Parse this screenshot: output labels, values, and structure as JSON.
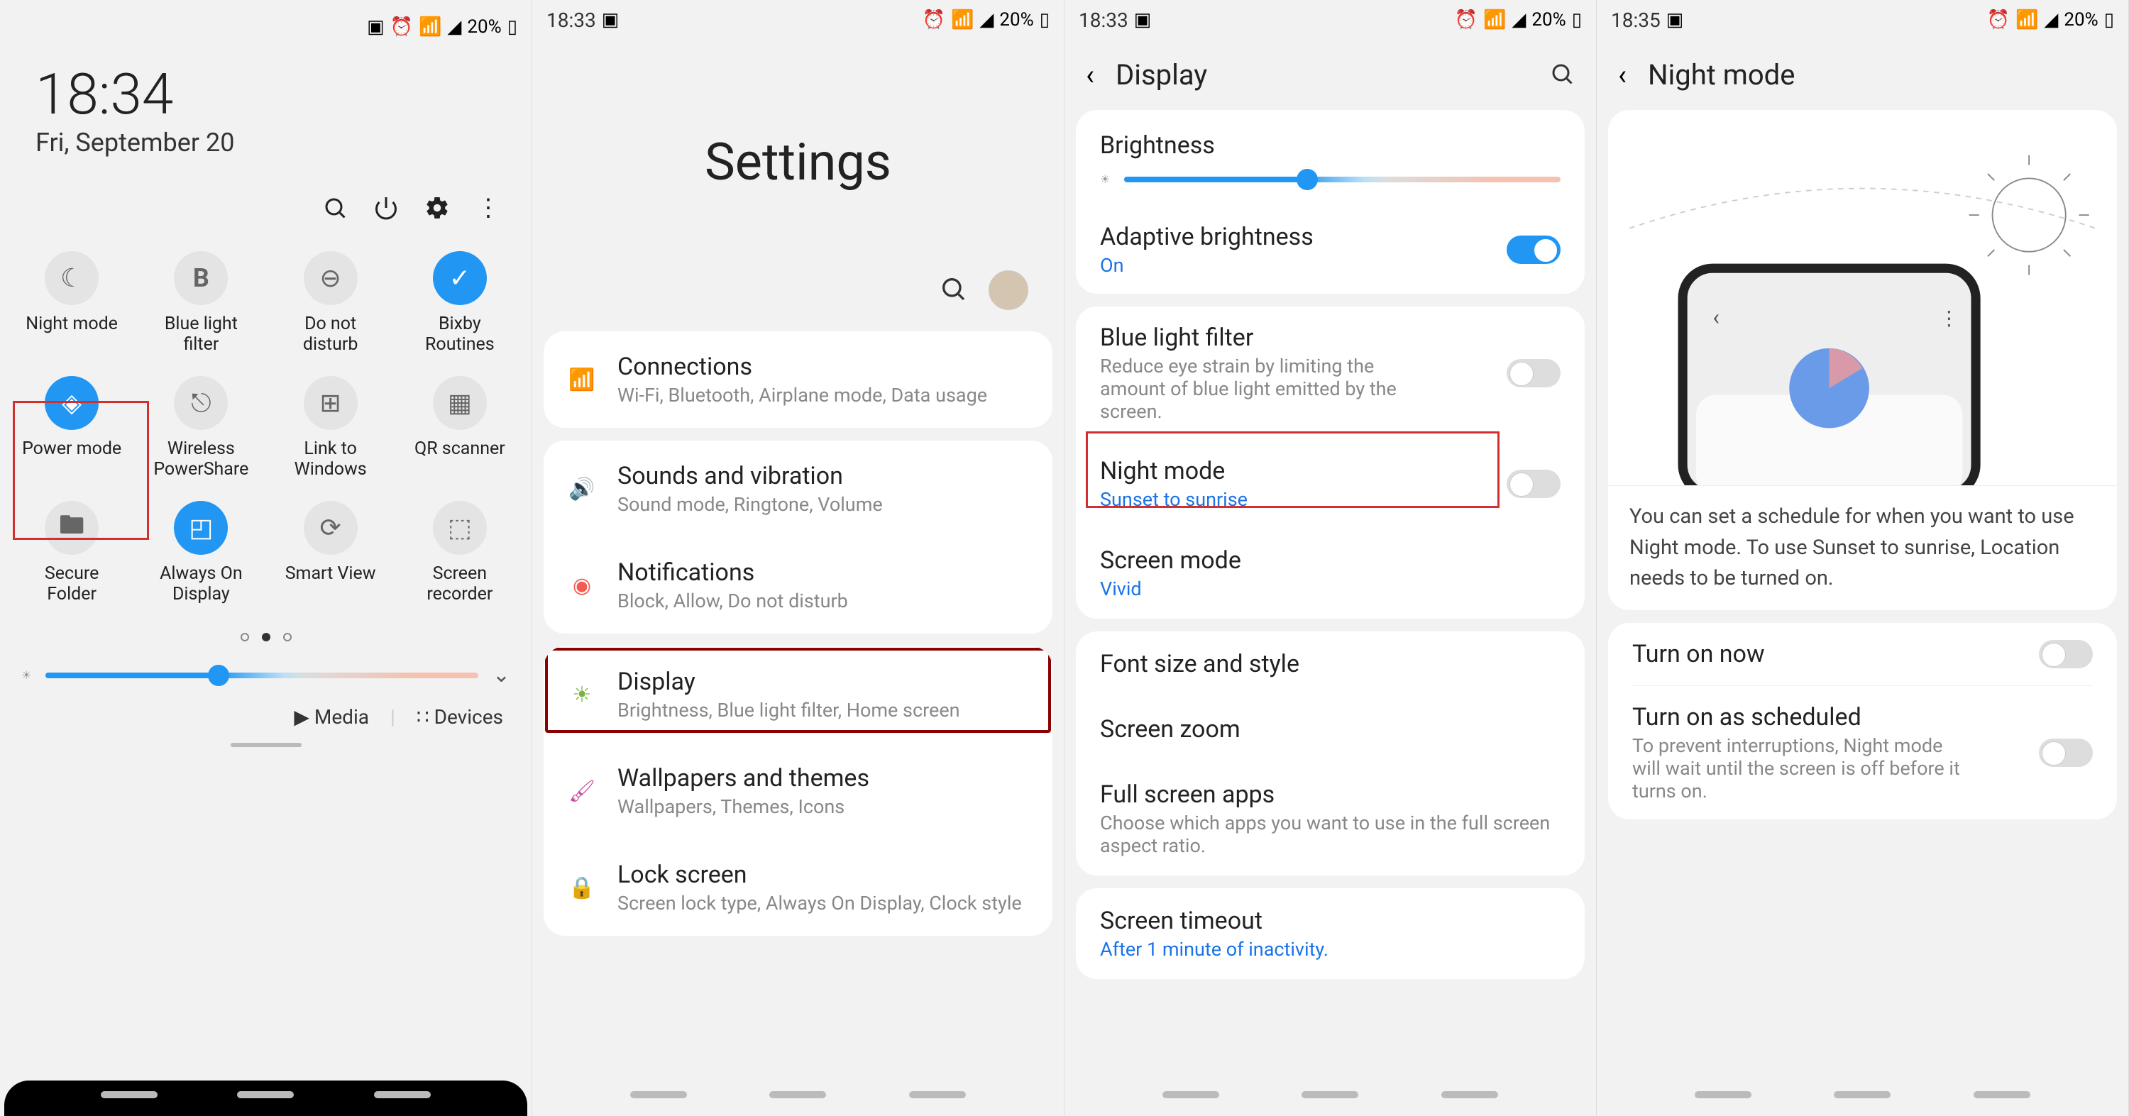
{
  "status": {
    "time1": "18:33",
    "time2": "18:33",
    "time3": "18:35",
    "battery": "20%"
  },
  "p1": {
    "time": "18:34",
    "date": "Fri, September 20",
    "tiles": [
      {
        "label": "Night mode",
        "active": false
      },
      {
        "label": "Blue light filter",
        "active": false
      },
      {
        "label": "Do not disturb",
        "active": false
      },
      {
        "label": "Bixby Routines",
        "active": true
      },
      {
        "label": "Power mode",
        "active": true
      },
      {
        "label": "Wireless PowerShare",
        "active": false
      },
      {
        "label": "Link to Windows",
        "active": false
      },
      {
        "label": "QR scanner",
        "active": false
      },
      {
        "label": "Secure Folder",
        "active": false
      },
      {
        "label": "Always On Display",
        "active": true
      },
      {
        "label": "Smart View",
        "active": false
      },
      {
        "label": "Screen recorder",
        "active": false
      }
    ],
    "media": "Media",
    "devices": "Devices"
  },
  "p2": {
    "title": "Settings",
    "items": [
      {
        "title": "Connections",
        "sub": "Wi-Fi, Bluetooth, Airplane mode, Data usage",
        "color": "#4aa3e8"
      },
      {
        "title": "Sounds and vibration",
        "sub": "Sound mode, Ringtone, Volume",
        "color": "#9b5de5"
      },
      {
        "title": "Notifications",
        "sub": "Block, Allow, Do not disturb",
        "color": "#f15b50"
      },
      {
        "title": "Display",
        "sub": "Brightness, Blue light filter, Home screen",
        "color": "#7cb342"
      },
      {
        "title": "Wallpapers and themes",
        "sub": "Wallpapers, Themes, Icons",
        "color": "#c44b9b"
      },
      {
        "title": "Lock screen",
        "sub": "Screen lock type, Always On Display, Clock style",
        "color": "#6c7ac9"
      }
    ]
  },
  "p3": {
    "title": "Display",
    "brightness": "Brightness",
    "adaptive": {
      "title": "Adaptive brightness",
      "sub": "On"
    },
    "bluelight": {
      "title": "Blue light filter",
      "sub": "Reduce eye strain by limiting the amount of blue light emitted by the screen."
    },
    "nightmode": {
      "title": "Night mode",
      "sub": "Sunset to sunrise"
    },
    "screenmode": {
      "title": "Screen mode",
      "sub": "Vivid"
    },
    "fontsize": "Font size and style",
    "zoom": "Screen zoom",
    "fullscreen": {
      "title": "Full screen apps",
      "sub": "Choose which apps you want to use in the full screen aspect ratio."
    },
    "timeout": {
      "title": "Screen timeout",
      "sub": "After 1 minute of inactivity."
    }
  },
  "p4": {
    "title": "Night mode",
    "desc": "You can set a schedule for when you want to use Night mode. To use Sunset to sunrise, Location needs to be turned on.",
    "turnon": "Turn on now",
    "schedule": {
      "title": "Turn on as scheduled",
      "sub": "To prevent interruptions, Night mode will wait until the screen is off before it turns on."
    }
  }
}
